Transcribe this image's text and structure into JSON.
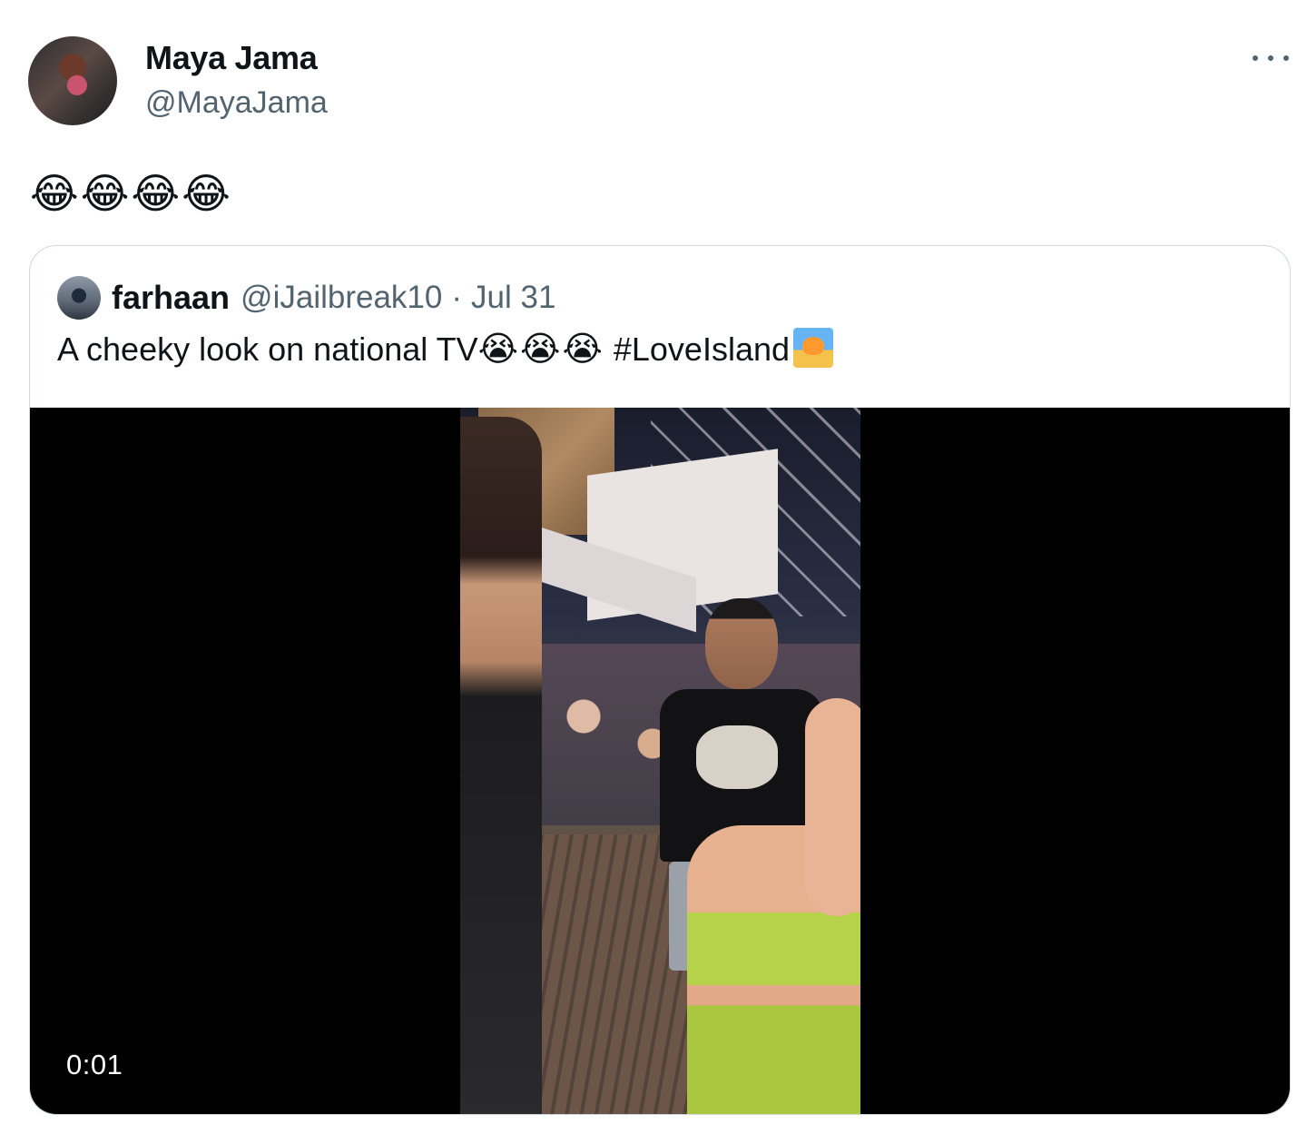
{
  "tweet": {
    "author_name": "Maya Jama",
    "author_handle": "@MayaJama",
    "text": "😂😂😂😂",
    "more_icon": "ellipsis-icon"
  },
  "quote": {
    "author_name": "farhaan",
    "author_handle": "@iJailbreak10",
    "separator": "·",
    "date": "Jul 31",
    "text": "A cheeky look on national TV",
    "emojis": "😭😭😭",
    "hashtag": " #LoveIsland"
  },
  "video": {
    "timestamp": "0:01"
  }
}
